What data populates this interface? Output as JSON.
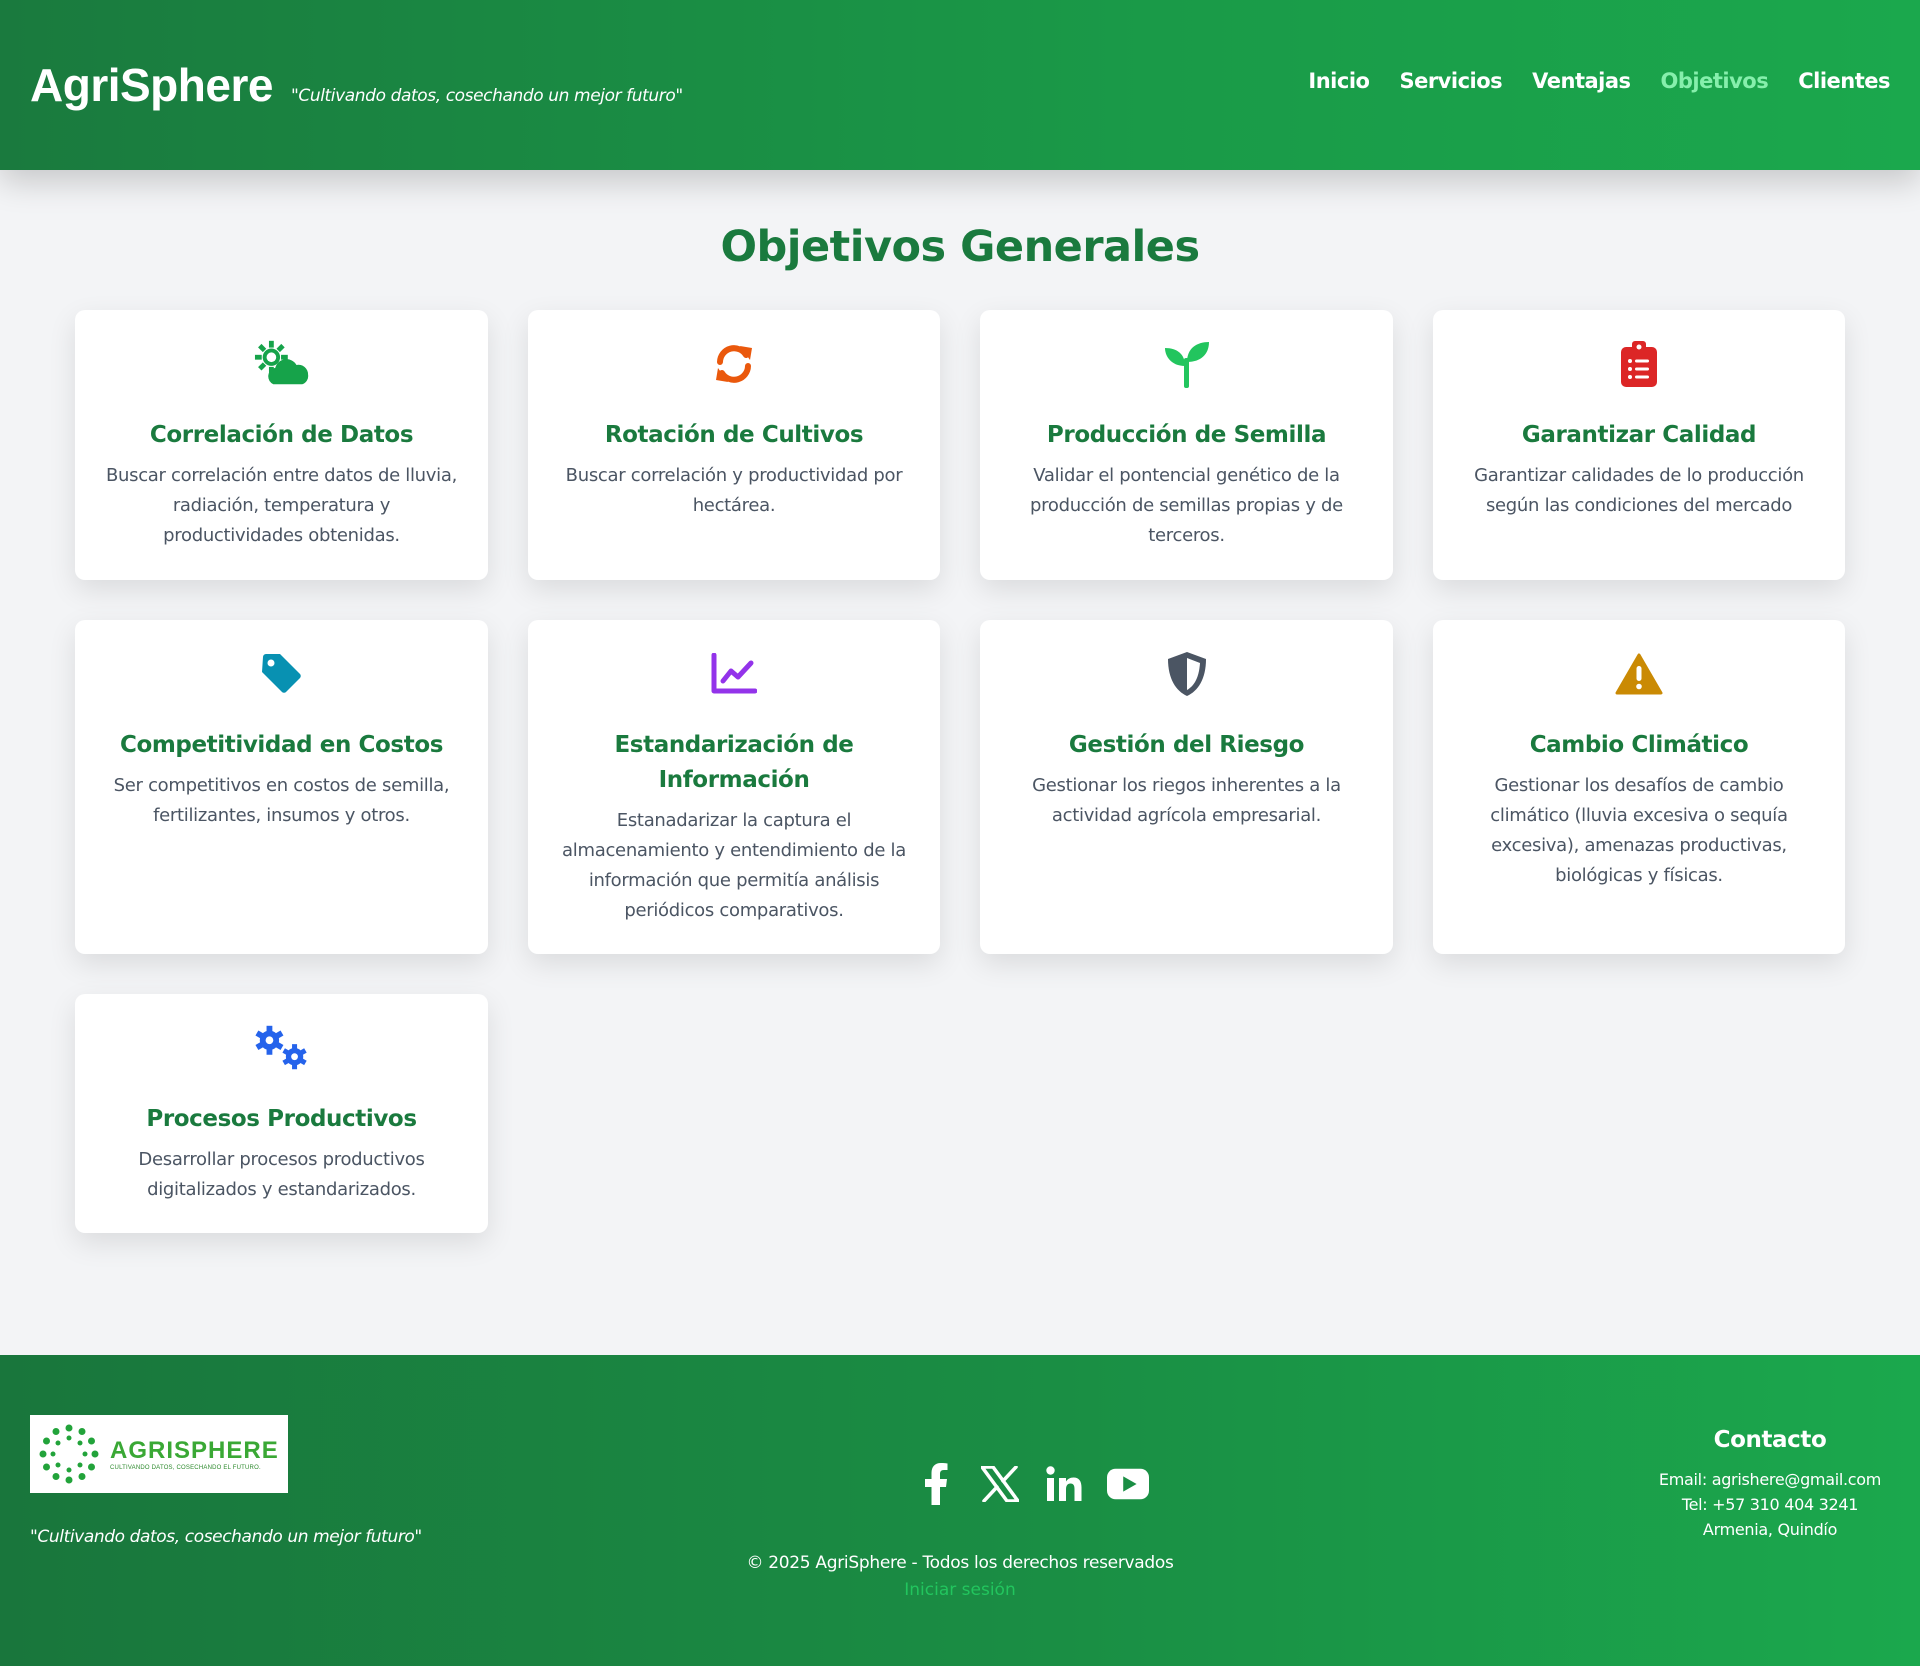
{
  "header": {
    "brand": "AgriSphere",
    "tagline": "\"Cultivando datos, cosechando un mejor futuro\"",
    "nav": [
      {
        "label": "Inicio",
        "active": false
      },
      {
        "label": "Servicios",
        "active": false
      },
      {
        "label": "Ventajas",
        "active": false
      },
      {
        "label": "Objetivos",
        "active": true
      },
      {
        "label": "Clientes",
        "active": false
      }
    ]
  },
  "main": {
    "title": "Objetivos Generales",
    "cards": [
      {
        "icon": "cloud-sun-icon",
        "color": "#16a34a",
        "title": "Correlación de Datos",
        "desc": "Buscar correlación entre datos de lluvia, radiación, temperatura y productividades obtenidas."
      },
      {
        "icon": "sync-icon",
        "color": "#ea580c",
        "title": "Rotación de Cultivos",
        "desc": "Buscar correlación y productividad por hectárea."
      },
      {
        "icon": "seedling-icon",
        "color": "#22c55e",
        "title": "Producción de Semilla",
        "desc": "Validar el pontencial genético de la producción de semillas propias y de terceros."
      },
      {
        "icon": "clipboard-list-icon",
        "color": "#dc2626",
        "title": "Garantizar Calidad",
        "desc": "Garantizar calidades de lo producción según las condiciones del mercado"
      },
      {
        "icon": "tag-icon",
        "color": "#0891b2",
        "title": "Competitividad en Costos",
        "desc": "Ser competitivos en costos de semilla, fertilizantes, insumos y otros."
      },
      {
        "icon": "chart-line-icon",
        "color": "#9333ea",
        "title": "Estandarización de Información",
        "desc": "Estanadarizar la captura el almacenamiento y entendimiento de la información que permitía análisis periódicos comparativos."
      },
      {
        "icon": "shield-icon",
        "color": "#4b5563",
        "title": "Gestión del Riesgo",
        "desc": "Gestionar los riegos inherentes a la actividad agrícola empresarial."
      },
      {
        "icon": "warning-icon",
        "color": "#ca8a04",
        "title": "Cambio Climático",
        "desc": "Gestionar los desafíos de cambio climático (lluvia excesiva o sequía excesiva), amenazas productivas, biológicas y físicas."
      },
      {
        "icon": "cogs-icon",
        "color": "#2563eb",
        "title": "Procesos Productivos",
        "desc": "Desarrollar procesos productivos digitalizados y estandarizados."
      }
    ]
  },
  "footer": {
    "logo_word": "AGRISPHERE",
    "logo_sub": "CULTIVANDO DATOS, COSECHANDO EL FUTURO.",
    "tagline": "\"Cultivando datos, cosechando un mejor futuro\"",
    "socials": [
      "facebook-icon",
      "x-icon",
      "linkedin-icon",
      "youtube-icon"
    ],
    "copyright": "© 2025 AgriSphere - Todos los derechos reservados",
    "login": "Iniciar sesión",
    "contact": {
      "title": "Contacto",
      "email": "Email: agrishere@gmail.com",
      "phone": "Tel: +57 310 404 3241",
      "city": "Armenia, Quindío"
    }
  }
}
